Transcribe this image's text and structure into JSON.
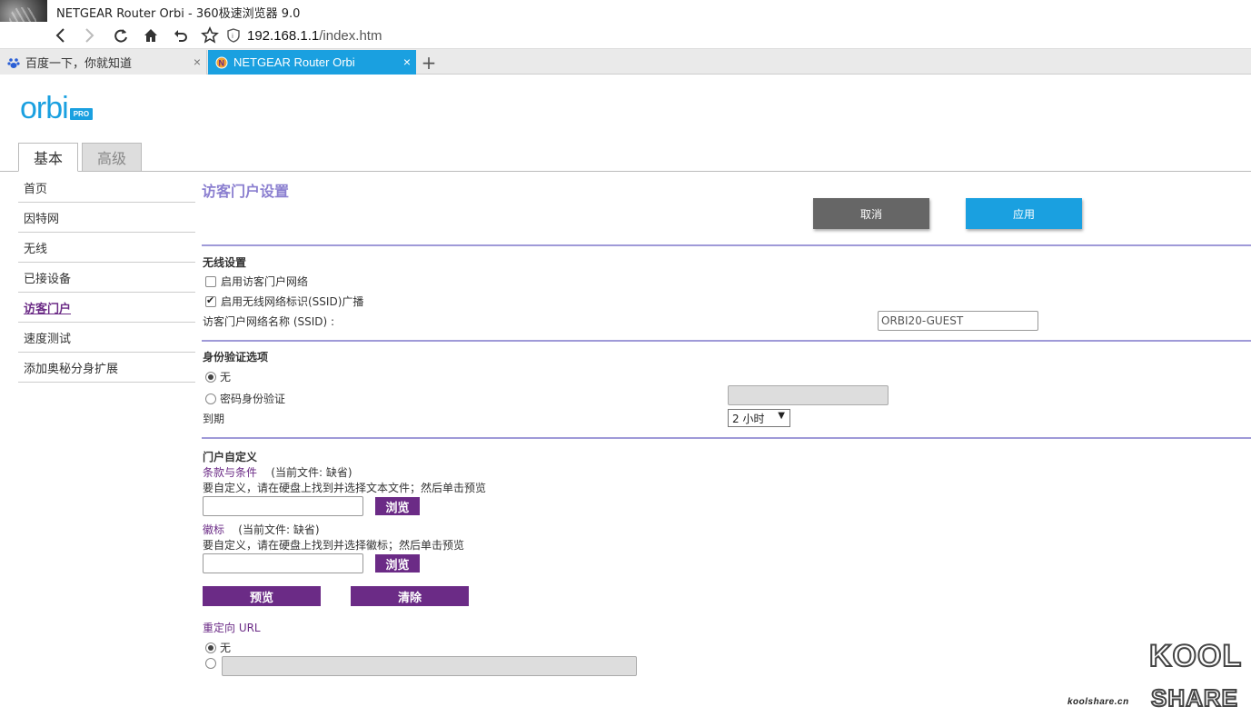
{
  "browser": {
    "window_title": "NETGEAR Router Orbi - 360极速浏览器 9.0",
    "url_host": "192.168.1.1",
    "url_path": "/index.htm",
    "tabs": [
      {
        "label": "百度一下，你就知道",
        "icon": "baidu-paw-icon",
        "active": false
      },
      {
        "label": "NETGEAR Router Orbi",
        "icon": "netgear-n-icon",
        "active": true
      }
    ],
    "new_tab_label": "+",
    "close_glyph": "×",
    "accent_color": "#1aa0e0"
  },
  "logo": {
    "text": "orbi",
    "badge": "PRO"
  },
  "main_tabs": [
    {
      "label": "基本",
      "active": true
    },
    {
      "label": "高级",
      "active": false
    }
  ],
  "sidebar": {
    "items": [
      {
        "label": "首页"
      },
      {
        "label": "因特网"
      },
      {
        "label": "无线"
      },
      {
        "label": "已接设备"
      },
      {
        "label": "访客门户",
        "active": true
      },
      {
        "label": "速度测试"
      },
      {
        "label": "添加奥秘分身扩展"
      }
    ]
  },
  "page": {
    "title": "访客门户设置",
    "cancel_label": "取消",
    "apply_label": "应用",
    "wireless": {
      "section_title": "无线设置",
      "enable_guest_label": "启用访客门户网络",
      "enable_guest_checked": false,
      "ssid_broadcast_label": "启用无线网络标识(SSID)广播",
      "ssid_broadcast_checked": true,
      "ssid_name_label": "访客门户网络名称 (SSID) :",
      "ssid_value": "ORBI20-GUEST"
    },
    "auth": {
      "section_title": "身份验证选项",
      "option_none": "无",
      "option_password": "密码身份验证",
      "selected": "none",
      "password_value": "",
      "expire_label": "到期",
      "expire_value": "2 小时",
      "dropdown_arrow": "▼"
    },
    "portal": {
      "section_title": "门户自定义",
      "terms_label": "条款与条件",
      "terms_current": "(当前文件: 缺省)",
      "terms_hint": "要自定义，请在硬盘上找到并选择文本文件；然后单击预览",
      "browse_label": "浏览",
      "logo_label": "徽标",
      "logo_current": "(当前文件: 缺省)",
      "logo_hint": "要自定义，请在硬盘上找到并选择徽标；然后单击预览",
      "preview_label": "预览",
      "clear_label": "清除",
      "redirect_label": "重定向 URL",
      "redirect_none": "无",
      "redirect_selected": "none",
      "redirect_url_value": ""
    }
  },
  "watermark": {
    "small": "koolshare.cn",
    "big_top": "KOOL",
    "big_bottom": "SHARE"
  },
  "colors": {
    "brand_blue": "#1aa0e0",
    "purple": "#6b2b86",
    "title_lavender": "#8b7fd0",
    "divider": "#9f9ad8"
  }
}
